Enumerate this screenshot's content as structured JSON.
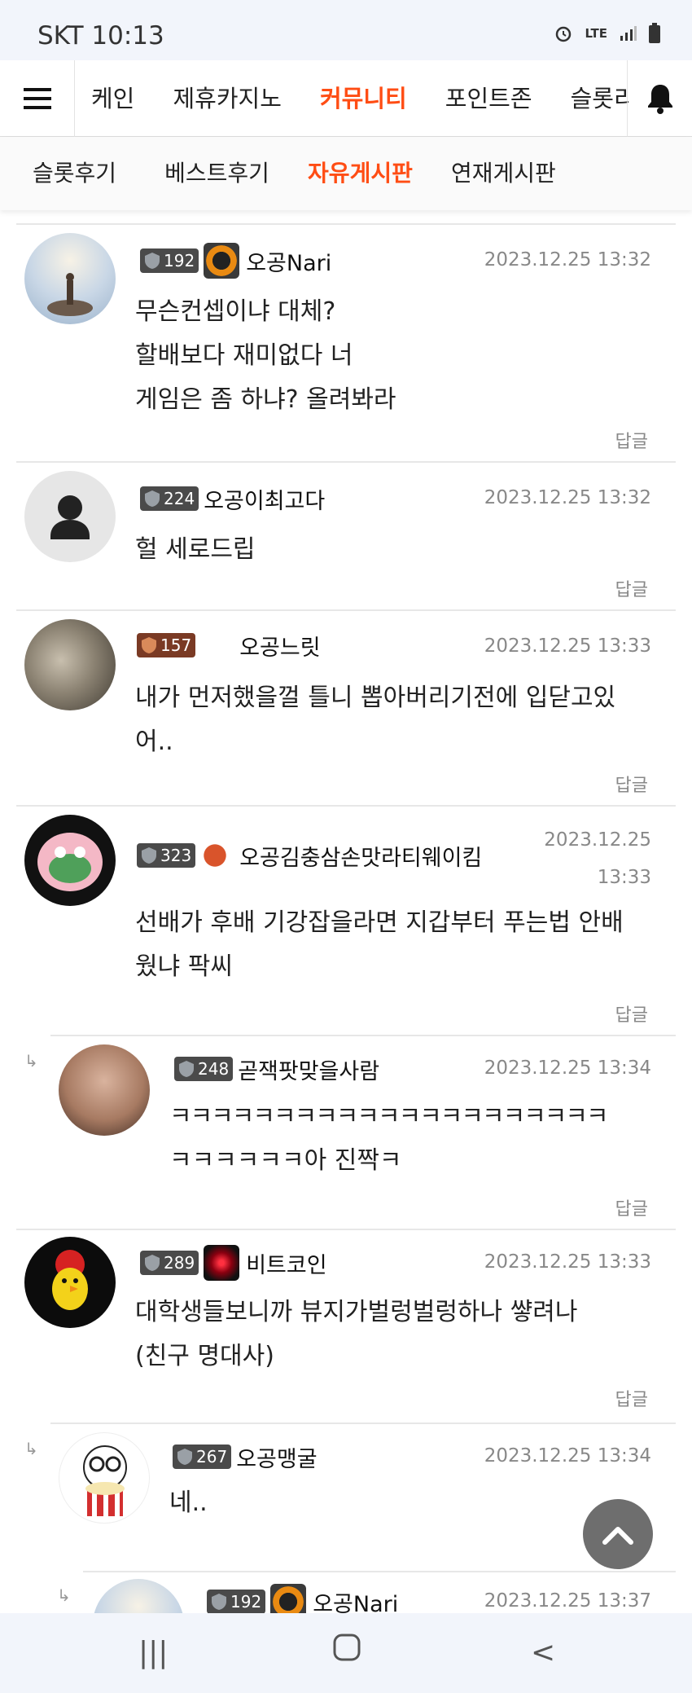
{
  "status_bar": {
    "carrier_time": "SKT 10:13",
    "icons": [
      "alarm-icon",
      "lte-icon",
      "signal-icon",
      "battery-icon"
    ],
    "lte": "LTE"
  },
  "top_nav": {
    "items": [
      "케인",
      "제휴카지노",
      "커뮤니티",
      "포인트존",
      "슬롯리"
    ],
    "active": "커뮤니티"
  },
  "sub_nav": {
    "items": [
      "슬롯후기",
      "베스트후기",
      "자유게시판",
      "연재게시판"
    ],
    "active": "자유게시판"
  },
  "comments": [
    {
      "level": "192",
      "nick": "오공Nari",
      "date": "2023.12.25 13:32",
      "lines": [
        "무슨컨셉이냐 대체?",
        "할배보다 재미없다 너",
        "게임은 좀 하냐? 올려봐라"
      ],
      "reply": "답글"
    },
    {
      "level": "224",
      "nick": "오공이최고다",
      "date": "2023.12.25 13:32",
      "lines": [
        "헐 세로드립"
      ],
      "reply": "답글"
    },
    {
      "level": "157",
      "nick": "오공느릿",
      "date": "2023.12.25 13:33",
      "lines": [
        "내가 먼저했을껄 틀니 뽑아버리기전에 입닫고있",
        "어.."
      ],
      "reply": "답글"
    },
    {
      "level": "323",
      "nick": "오공김충삼손맛라티웨이킴",
      "date_lines": [
        "2023.12.25",
        "13:33"
      ],
      "lines": [
        "선배가 후배 기강잡을라면 지갑부터 푸는법 안배",
        "웠냐 팍씨"
      ],
      "reply": "답글"
    },
    {
      "level": "248",
      "nick": "곧잭팟맞을사람",
      "date": "2023.12.25 13:34",
      "lines": [
        "ㅋㅋㅋㅋㅋㅋㅋㅋㅋㅋㅋㅋㅋㅋㅋㅋㅋㅋㅋㅋㅋ",
        "ㅋㅋㅋㅋㅋㅋ아 진짝ㅋ"
      ],
      "reply": "답글"
    },
    {
      "level": "289",
      "nick": "비트코인",
      "date": "2023.12.25 13:33",
      "lines": [
        "대학생들보니까 뷰지가벌렁벌렁하나 썋려나",
        "(친구 명대사)"
      ],
      "reply": "답글"
    },
    {
      "level": "267",
      "nick": "오공맹굴",
      "date": "2023.12.25 13:34",
      "lines": [
        "네.."
      ],
      "reply": "답글"
    },
    {
      "level": "192",
      "nick": "오공Nari",
      "date": "2023.12.25 13:37",
      "lines": [],
      "reply": ""
    }
  ],
  "colors": {
    "accent": "#ff4d14",
    "level_badge": "#4a4a4a",
    "date": "#888888"
  }
}
